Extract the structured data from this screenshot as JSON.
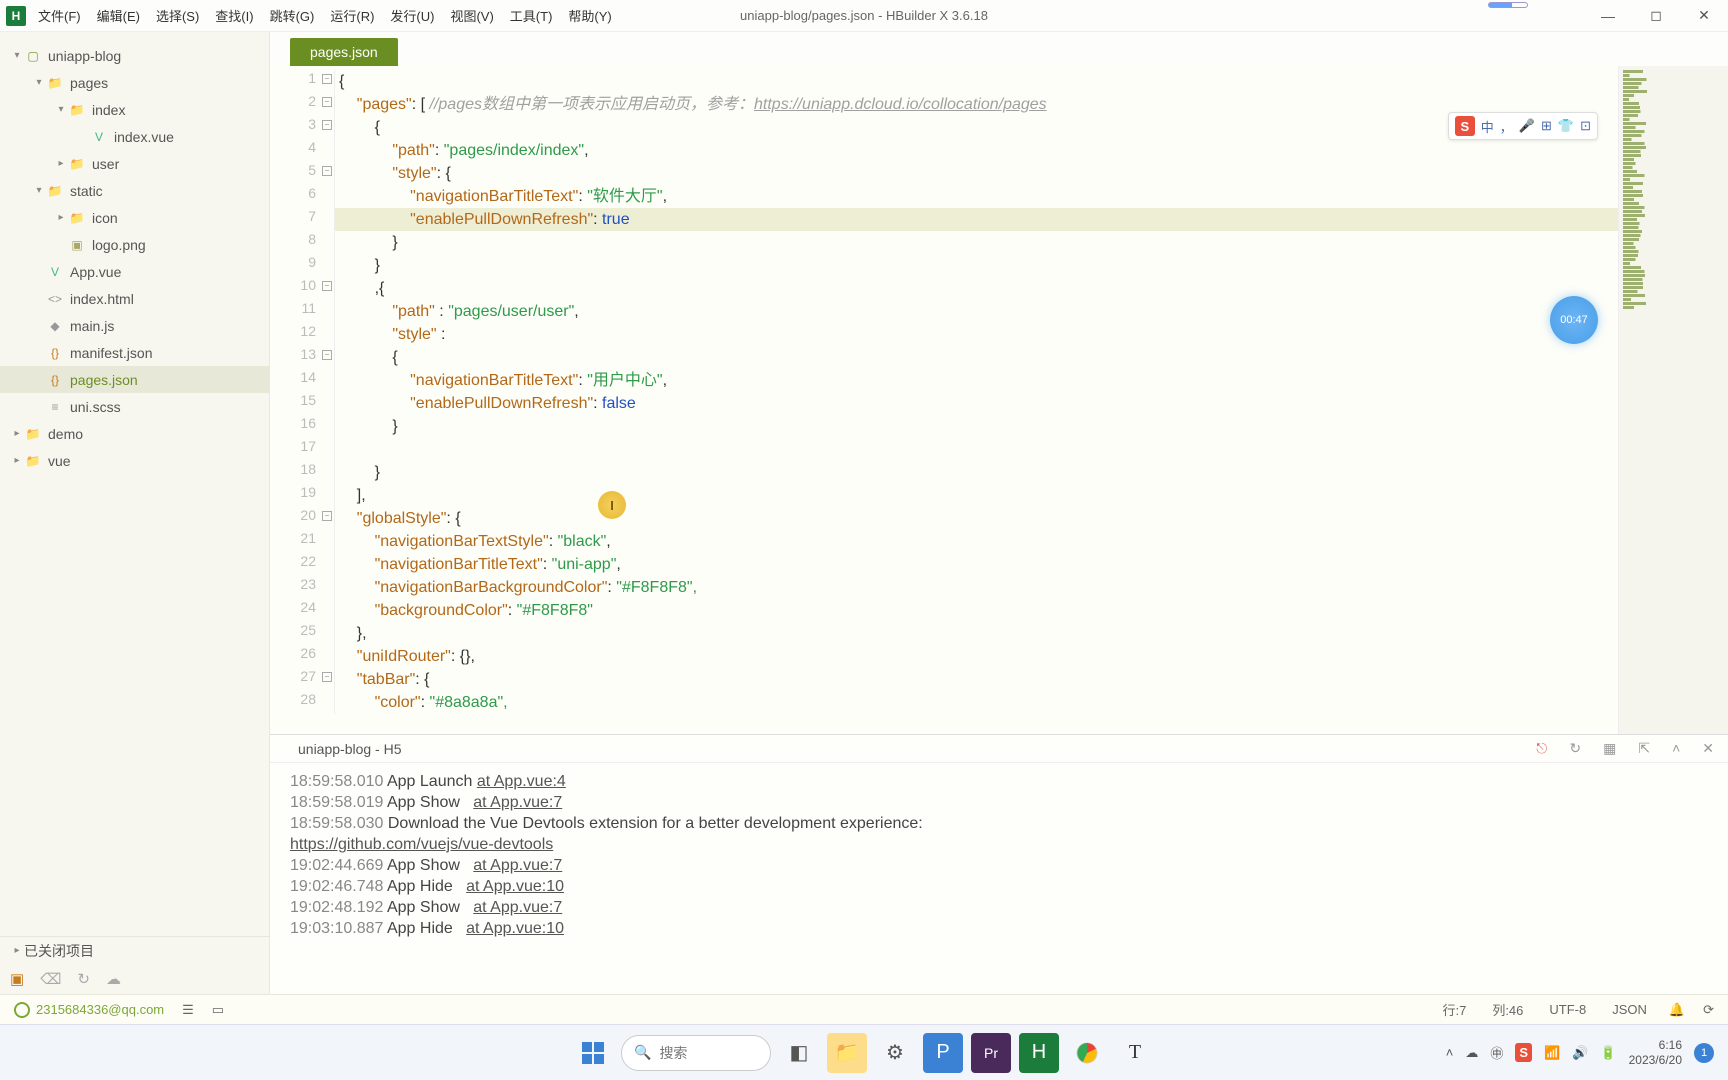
{
  "titlebar": {
    "menus": [
      "文件(F)",
      "编辑(E)",
      "选择(S)",
      "查找(I)",
      "跳转(G)",
      "运行(R)",
      "发行(U)",
      "视图(V)",
      "工具(T)",
      "帮助(Y)"
    ],
    "title": "uniapp-blog/pages.json - HBuilder X 3.6.18"
  },
  "sidebar": {
    "tree": [
      {
        "indent": 0,
        "arrow": "▾",
        "icon": "greenfolder",
        "label": "uniapp-blog"
      },
      {
        "indent": 1,
        "arrow": "▾",
        "icon": "folder",
        "label": "pages"
      },
      {
        "indent": 2,
        "arrow": "▾",
        "icon": "folder",
        "label": "index"
      },
      {
        "indent": 3,
        "arrow": "",
        "icon": "vuefile",
        "label": "index.vue"
      },
      {
        "indent": 2,
        "arrow": "▸",
        "icon": "folder",
        "label": "user"
      },
      {
        "indent": 1,
        "arrow": "▾",
        "icon": "folder",
        "label": "static"
      },
      {
        "indent": 2,
        "arrow": "▸",
        "icon": "folder",
        "label": "icon"
      },
      {
        "indent": 2,
        "arrow": "",
        "icon": "imgfile",
        "label": "logo.png"
      },
      {
        "indent": 1,
        "arrow": "",
        "icon": "vuefile",
        "label": "App.vue"
      },
      {
        "indent": 1,
        "arrow": "",
        "icon": "htmlfile",
        "label": "index.html"
      },
      {
        "indent": 1,
        "arrow": "",
        "icon": "jsfile",
        "label": "main.js"
      },
      {
        "indent": 1,
        "arrow": "",
        "icon": "jsonfile",
        "label": "manifest.json"
      },
      {
        "indent": 1,
        "arrow": "",
        "icon": "jsonfile",
        "label": "pages.json",
        "selected": true
      },
      {
        "indent": 1,
        "arrow": "",
        "icon": "cssfile",
        "label": "uni.scss"
      },
      {
        "indent": 0,
        "arrow": "▸",
        "icon": "folder",
        "label": "demo"
      },
      {
        "indent": 0,
        "arrow": "▸",
        "icon": "folder",
        "label": "vue"
      }
    ],
    "closed_projects": "已关闭项目"
  },
  "tabs": {
    "active": "pages.json"
  },
  "code": {
    "comment_prefix": "//pages数组中第一项表示应用启动页，参考：",
    "comment_url": "https://uniapp.dcloud.io/collocation/pages",
    "lines": [
      "{",
      "\t\"pages\": [ ",
      "\t\t{",
      "\t\t\t\"path\": \"pages/index/index\",",
      "\t\t\t\"style\": {",
      "\t\t\t\t\"navigationBarTitleText\": \"软件大厅\",",
      "\t\t\t\t\"enablePullDownRefresh\": true",
      "\t\t\t}",
      "\t\t}",
      "\t\t,{",
      "\t\t\t\"path\" : \"pages/user/user\",",
      "\t\t\t\"style\" :",
      "\t\t\t{",
      "\t\t\t\t\"navigationBarTitleText\": \"用户中心\",",
      "\t\t\t\t\"enablePullDownRefresh\": false",
      "\t\t\t}",
      "\t\t\t",
      "\t\t}",
      "\t],",
      "\t\"globalStyle\": {",
      "\t\t\"navigationBarTextStyle\": \"black\",",
      "\t\t\"navigationBarTitleText\": \"uni-app\",",
      "\t\t\"navigationBarBackgroundColor\": \"#F8F8F8\",",
      "\t\t\"backgroundColor\": \"#F8F8F8\"",
      "\t},",
      "\t\"uniIdRouter\": {},",
      "\t\"tabBar\": {",
      "\t\t\"color\": \"#8a8a8a\","
    ],
    "highlight_line": 7,
    "fold_lines": [
      1,
      2,
      3,
      5,
      10,
      13,
      20,
      27
    ]
  },
  "floating_toolbar": {
    "items": [
      "中",
      "，",
      "🎤",
      "⊞",
      "👕",
      "⊡"
    ]
  },
  "timer": "00:47",
  "console": {
    "tab": "uniapp-blog - H5",
    "lines": [
      {
        "ts": "18:59:58.010",
        "msg": "App Launch ",
        "link": "at App.vue:4"
      },
      {
        "ts": "18:59:58.019",
        "msg": "App Show   ",
        "link": "at App.vue:7"
      },
      {
        "ts": "18:59:58.030",
        "msg": "Download the Vue Devtools extension for a better development experience:",
        "link": ""
      },
      {
        "ts": "",
        "msg": "",
        "link": "https://github.com/vuejs/vue-devtools"
      },
      {
        "ts": "19:02:44.669",
        "msg": "App Show   ",
        "link": "at App.vue:7"
      },
      {
        "ts": "19:02:46.748",
        "msg": "App Hide   ",
        "link": "at App.vue:10"
      },
      {
        "ts": "19:02:48.192",
        "msg": "App Show   ",
        "link": "at App.vue:7"
      },
      {
        "ts": "19:03:10.887",
        "msg": "App Hide   ",
        "link": "at App.vue:10"
      }
    ]
  },
  "statusbar": {
    "user": "2315684336@qq.com",
    "line": "行:7",
    "col": "列:46",
    "encoding": "UTF-8",
    "lang": "JSON"
  },
  "taskbar": {
    "search_placeholder": "搜索",
    "time": "6:16",
    "date": "2023/6/20",
    "notif": "1"
  }
}
